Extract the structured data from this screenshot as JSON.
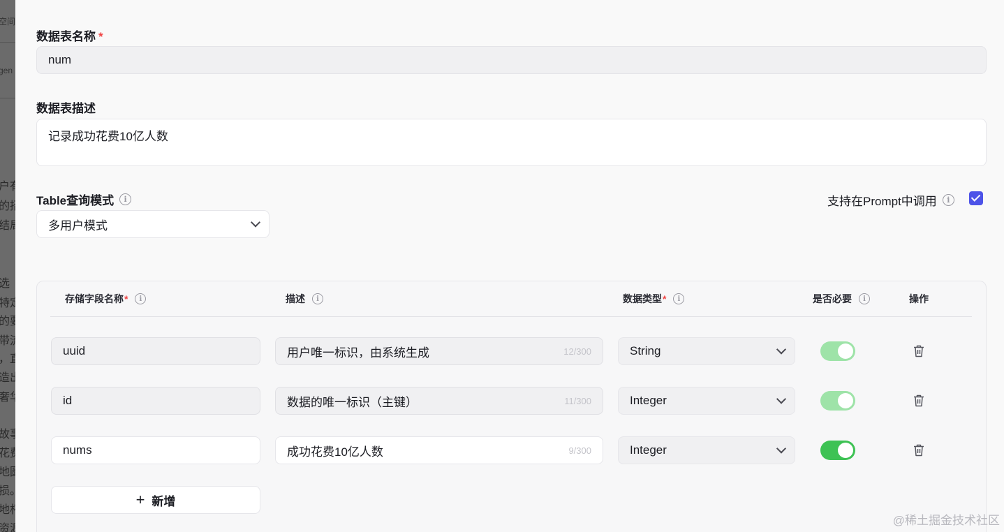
{
  "background_page": {
    "lines": [
      "空间",
      "gen",
      "户有",
      "的招",
      "结局",
      "选",
      "特定",
      "的要",
      "带流",
      "，直",
      "造出",
      "奢华",
      "故事",
      "花费",
      "地圖",
      "损。",
      "地杯",
      "资源"
    ]
  },
  "form": {
    "table_name_label": "数据表名称",
    "required_mark": "*",
    "table_name_value": "num",
    "table_desc_label": "数据表描述",
    "table_desc_value": "记录成功花费10亿人数",
    "query_mode_label": "Table查询模式",
    "query_mode_value": "多用户模式",
    "prompt_support_label": "支持在Prompt中调用",
    "prompt_support_checked": true
  },
  "table": {
    "headers": {
      "field_name": "存储字段名称",
      "description": "描述",
      "data_type": "数据类型",
      "required": "是否必要",
      "actions": "操作"
    },
    "rows": [
      {
        "name": "uuid",
        "description": "用户唯一标识，由系统生成",
        "counter": "12/300",
        "type": "String",
        "required": true,
        "editable": false
      },
      {
        "name": "id",
        "description": "数据的唯一标识（主键）",
        "counter": "11/300",
        "type": "Integer",
        "required": true,
        "editable": false
      },
      {
        "name": "nums",
        "description": "成功花费10亿人数",
        "counter": "9/300",
        "type": "Integer",
        "required": true,
        "editable": true
      }
    ],
    "add_label": "新增"
  },
  "watermark": "@稀土掘金技术社区",
  "colors": {
    "accent": "#4d53e8",
    "toggle_on": "#3ec254",
    "toggle_on_disabled": "#9ee3a8",
    "required": "#f04343"
  }
}
